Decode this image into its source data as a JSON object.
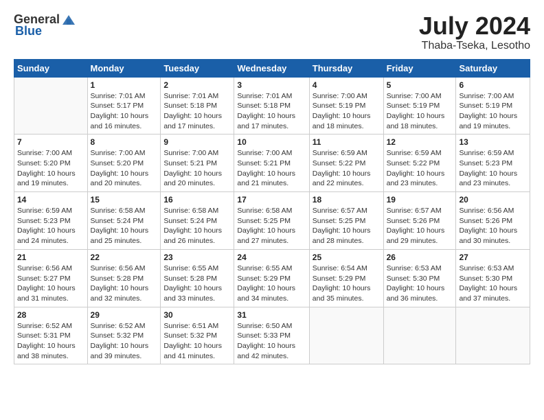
{
  "header": {
    "logo_general": "General",
    "logo_blue": "Blue",
    "title": "July 2024",
    "subtitle": "Thaba-Tseka, Lesotho"
  },
  "weekdays": [
    "Sunday",
    "Monday",
    "Tuesday",
    "Wednesday",
    "Thursday",
    "Friday",
    "Saturday"
  ],
  "weeks": [
    [
      {
        "day": "",
        "info": ""
      },
      {
        "day": "1",
        "info": "Sunrise: 7:01 AM\nSunset: 5:17 PM\nDaylight: 10 hours\nand 16 minutes."
      },
      {
        "day": "2",
        "info": "Sunrise: 7:01 AM\nSunset: 5:18 PM\nDaylight: 10 hours\nand 17 minutes."
      },
      {
        "day": "3",
        "info": "Sunrise: 7:01 AM\nSunset: 5:18 PM\nDaylight: 10 hours\nand 17 minutes."
      },
      {
        "day": "4",
        "info": "Sunrise: 7:00 AM\nSunset: 5:19 PM\nDaylight: 10 hours\nand 18 minutes."
      },
      {
        "day": "5",
        "info": "Sunrise: 7:00 AM\nSunset: 5:19 PM\nDaylight: 10 hours\nand 18 minutes."
      },
      {
        "day": "6",
        "info": "Sunrise: 7:00 AM\nSunset: 5:19 PM\nDaylight: 10 hours\nand 19 minutes."
      }
    ],
    [
      {
        "day": "7",
        "info": "Sunrise: 7:00 AM\nSunset: 5:20 PM\nDaylight: 10 hours\nand 19 minutes."
      },
      {
        "day": "8",
        "info": "Sunrise: 7:00 AM\nSunset: 5:20 PM\nDaylight: 10 hours\nand 20 minutes."
      },
      {
        "day": "9",
        "info": "Sunrise: 7:00 AM\nSunset: 5:21 PM\nDaylight: 10 hours\nand 20 minutes."
      },
      {
        "day": "10",
        "info": "Sunrise: 7:00 AM\nSunset: 5:21 PM\nDaylight: 10 hours\nand 21 minutes."
      },
      {
        "day": "11",
        "info": "Sunrise: 6:59 AM\nSunset: 5:22 PM\nDaylight: 10 hours\nand 22 minutes."
      },
      {
        "day": "12",
        "info": "Sunrise: 6:59 AM\nSunset: 5:22 PM\nDaylight: 10 hours\nand 23 minutes."
      },
      {
        "day": "13",
        "info": "Sunrise: 6:59 AM\nSunset: 5:23 PM\nDaylight: 10 hours\nand 23 minutes."
      }
    ],
    [
      {
        "day": "14",
        "info": "Sunrise: 6:59 AM\nSunset: 5:23 PM\nDaylight: 10 hours\nand 24 minutes."
      },
      {
        "day": "15",
        "info": "Sunrise: 6:58 AM\nSunset: 5:24 PM\nDaylight: 10 hours\nand 25 minutes."
      },
      {
        "day": "16",
        "info": "Sunrise: 6:58 AM\nSunset: 5:24 PM\nDaylight: 10 hours\nand 26 minutes."
      },
      {
        "day": "17",
        "info": "Sunrise: 6:58 AM\nSunset: 5:25 PM\nDaylight: 10 hours\nand 27 minutes."
      },
      {
        "day": "18",
        "info": "Sunrise: 6:57 AM\nSunset: 5:25 PM\nDaylight: 10 hours\nand 28 minutes."
      },
      {
        "day": "19",
        "info": "Sunrise: 6:57 AM\nSunset: 5:26 PM\nDaylight: 10 hours\nand 29 minutes."
      },
      {
        "day": "20",
        "info": "Sunrise: 6:56 AM\nSunset: 5:26 PM\nDaylight: 10 hours\nand 30 minutes."
      }
    ],
    [
      {
        "day": "21",
        "info": "Sunrise: 6:56 AM\nSunset: 5:27 PM\nDaylight: 10 hours\nand 31 minutes."
      },
      {
        "day": "22",
        "info": "Sunrise: 6:56 AM\nSunset: 5:28 PM\nDaylight: 10 hours\nand 32 minutes."
      },
      {
        "day": "23",
        "info": "Sunrise: 6:55 AM\nSunset: 5:28 PM\nDaylight: 10 hours\nand 33 minutes."
      },
      {
        "day": "24",
        "info": "Sunrise: 6:55 AM\nSunset: 5:29 PM\nDaylight: 10 hours\nand 34 minutes."
      },
      {
        "day": "25",
        "info": "Sunrise: 6:54 AM\nSunset: 5:29 PM\nDaylight: 10 hours\nand 35 minutes."
      },
      {
        "day": "26",
        "info": "Sunrise: 6:53 AM\nSunset: 5:30 PM\nDaylight: 10 hours\nand 36 minutes."
      },
      {
        "day": "27",
        "info": "Sunrise: 6:53 AM\nSunset: 5:30 PM\nDaylight: 10 hours\nand 37 minutes."
      }
    ],
    [
      {
        "day": "28",
        "info": "Sunrise: 6:52 AM\nSunset: 5:31 PM\nDaylight: 10 hours\nand 38 minutes."
      },
      {
        "day": "29",
        "info": "Sunrise: 6:52 AM\nSunset: 5:32 PM\nDaylight: 10 hours\nand 39 minutes."
      },
      {
        "day": "30",
        "info": "Sunrise: 6:51 AM\nSunset: 5:32 PM\nDaylight: 10 hours\nand 41 minutes."
      },
      {
        "day": "31",
        "info": "Sunrise: 6:50 AM\nSunset: 5:33 PM\nDaylight: 10 hours\nand 42 minutes."
      },
      {
        "day": "",
        "info": ""
      },
      {
        "day": "",
        "info": ""
      },
      {
        "day": "",
        "info": ""
      }
    ]
  ]
}
